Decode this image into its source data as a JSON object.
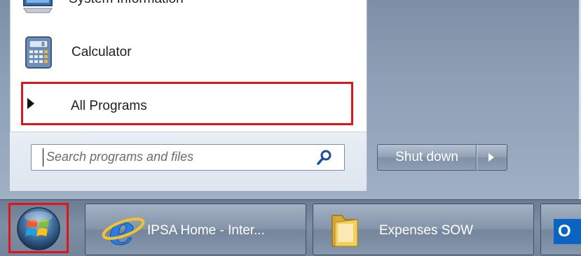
{
  "start_menu": {
    "items": [
      {
        "label": "System Information",
        "icon": "system-information-icon"
      },
      {
        "label": "Calculator",
        "icon": "calculator-icon"
      }
    ],
    "all_programs": {
      "label": "All Programs",
      "icon": "triangle-right-icon"
    },
    "search": {
      "placeholder": "Search programs and files",
      "icon": "search-icon"
    },
    "shutdown": {
      "label": "Shut down",
      "options_icon": "triangle-right-icon"
    }
  },
  "taskbar": {
    "start_button": {
      "icon": "windows-orb-icon"
    },
    "tasks": [
      {
        "label": "IPSA Home - Inter...",
        "icon": "internet-explorer-icon"
      },
      {
        "label": "Expenses SOW",
        "icon": "folder-icon"
      },
      {
        "label": "O",
        "icon": "outlook-icon"
      }
    ]
  },
  "colors": {
    "highlight_box": "#e0141b",
    "taskbar": "#7e8ea3",
    "menu_pane": "#ffffff",
    "glass_panel": "#8ea0b6"
  }
}
